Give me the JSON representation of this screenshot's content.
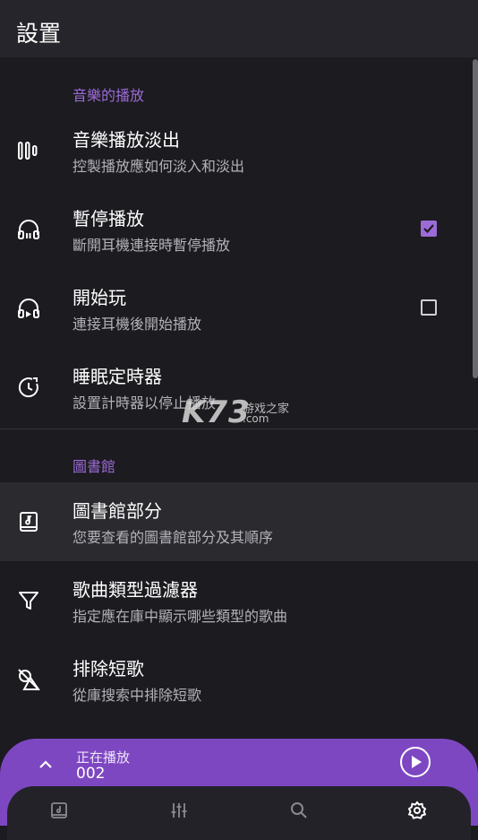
{
  "appbar": {
    "title": "設置"
  },
  "sections": {
    "playback": "音樂的播放",
    "library": "圖書館"
  },
  "rows": [
    {
      "label": "音樂播放淡出",
      "sub": "控製播放應如何淡入和淡出",
      "icon": "equalizer-bars-icon"
    },
    {
      "label": "暫停播放",
      "sub": "斷開耳機連接時暫停播放",
      "icon": "headphones-icon",
      "checked": true
    },
    {
      "label": "開始玩",
      "sub": "連接耳機後開始播放",
      "icon": "headphones-play-icon",
      "checked": false
    },
    {
      "label": "睡眠定時器",
      "sub": "設置計時器以停止播放",
      "icon": "sleep-timer-icon"
    },
    {
      "label": "圖書館部分",
      "sub": "您要查看的圖書館部分及其順序",
      "icon": "library-book-icon"
    },
    {
      "label": "歌曲類型過濾器",
      "sub": "指定應在庫中顯示哪些類型的歌曲",
      "icon": "filter-funnel-icon"
    },
    {
      "label": "排除短歌",
      "sub": "從庫搜索中排除短歌",
      "icon": "exclude-shapes-icon"
    }
  ],
  "watermark": {
    "logo": "K73",
    "cn": "游戏之家",
    "com": ".com"
  },
  "now_playing": {
    "label": "正在播放",
    "title": "002"
  },
  "bottom_nav": [
    "library-icon",
    "equalizer-icon",
    "search-icon",
    "settings-icon"
  ],
  "colors": {
    "accent": "#9b6bd6",
    "now_playing_bg": "#7e47c2",
    "background": "#1c1b20"
  }
}
